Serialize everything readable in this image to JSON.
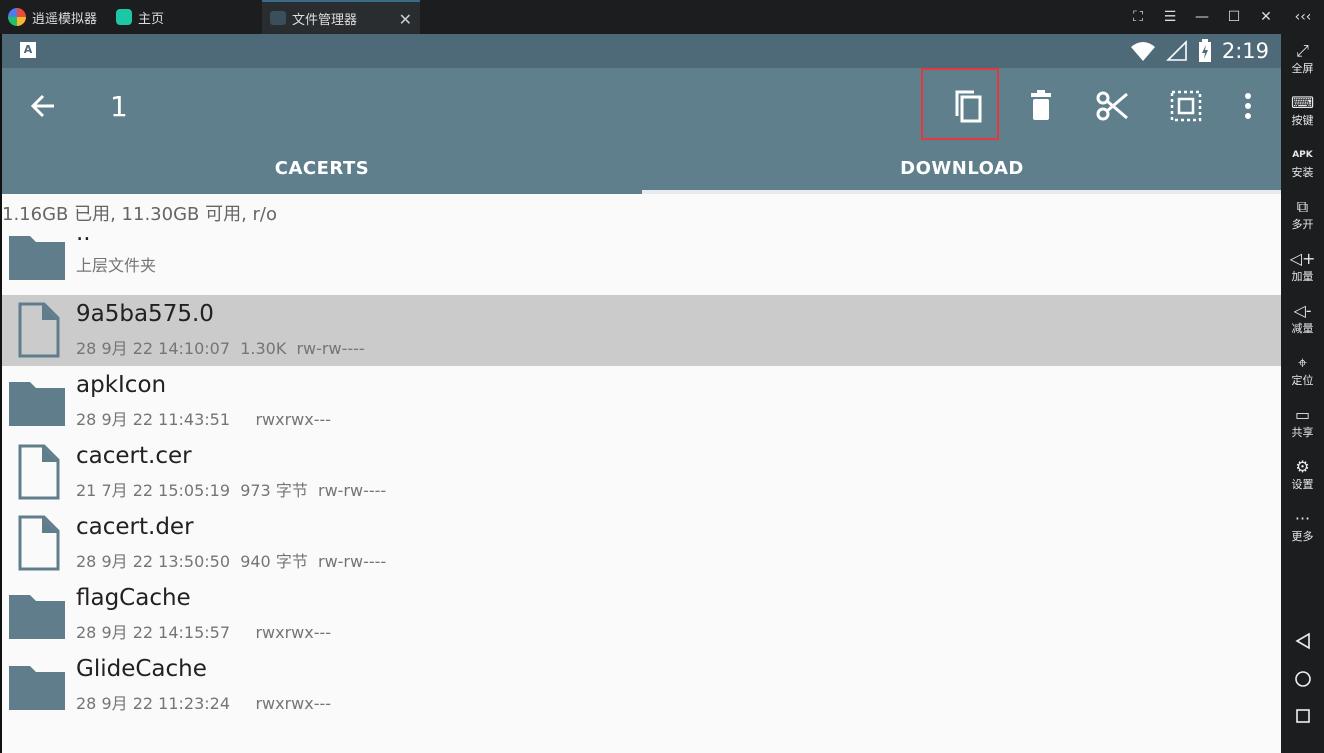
{
  "emulator": {
    "tabs": [
      {
        "label": "逍遥模拟器"
      },
      {
        "label": "主页"
      },
      {
        "label": "文件管理器"
      }
    ],
    "sidebar": [
      {
        "label": "全屏",
        "icon": "fullscreen-icon"
      },
      {
        "label": "按键",
        "icon": "keyboard-icon"
      },
      {
        "label": "安装",
        "icon": "apk-icon"
      },
      {
        "label": "多开",
        "icon": "multi-instance-icon"
      },
      {
        "label": "加量",
        "icon": "volume-up-icon"
      },
      {
        "label": "减量",
        "icon": "volume-down-icon"
      },
      {
        "label": "定位",
        "icon": "location-icon"
      },
      {
        "label": "共享",
        "icon": "folder-share-icon"
      },
      {
        "label": "设置",
        "icon": "gear-icon"
      },
      {
        "label": "更多",
        "icon": "more-dots-icon"
      }
    ]
  },
  "statusbar": {
    "time": "2:19",
    "notification_letter": "A"
  },
  "appbar": {
    "title": "1",
    "tabs": [
      {
        "label": "CACERTS"
      },
      {
        "label": "DOWNLOAD"
      }
    ]
  },
  "storage_info": "1.16GB 已用, 11.30GB 可用, r/o",
  "files": [
    {
      "name": "..",
      "meta": "上层文件夹",
      "type": "folder"
    },
    {
      "name": "9a5ba575.0",
      "meta": "28 9月 22 14:10:07  1.30K  rw-rw----",
      "type": "file",
      "selected": true
    },
    {
      "name": "apkIcon",
      "meta": "28 9月 22 11:43:51     rwxrwx---",
      "type": "folder"
    },
    {
      "name": "cacert.cer",
      "meta": "21 7月 22 15:05:19  973 字节  rw-rw----",
      "type": "file"
    },
    {
      "name": "cacert.der",
      "meta": "28 9月 22 13:50:50  940 字节  rw-rw----",
      "type": "file"
    },
    {
      "name": "flagCache",
      "meta": "28 9月 22 14:15:57     rwxrwx---",
      "type": "folder"
    },
    {
      "name": "GlideCache",
      "meta": "28 9月 22 11:23:24     rwxrwx---",
      "type": "folder"
    }
  ],
  "colors": {
    "appbar": "#5f7f8c",
    "statusbar": "#4e6a78",
    "folder": "#607d8b",
    "selected_row": "#cbcbcb",
    "highlight": "#e5393b"
  }
}
